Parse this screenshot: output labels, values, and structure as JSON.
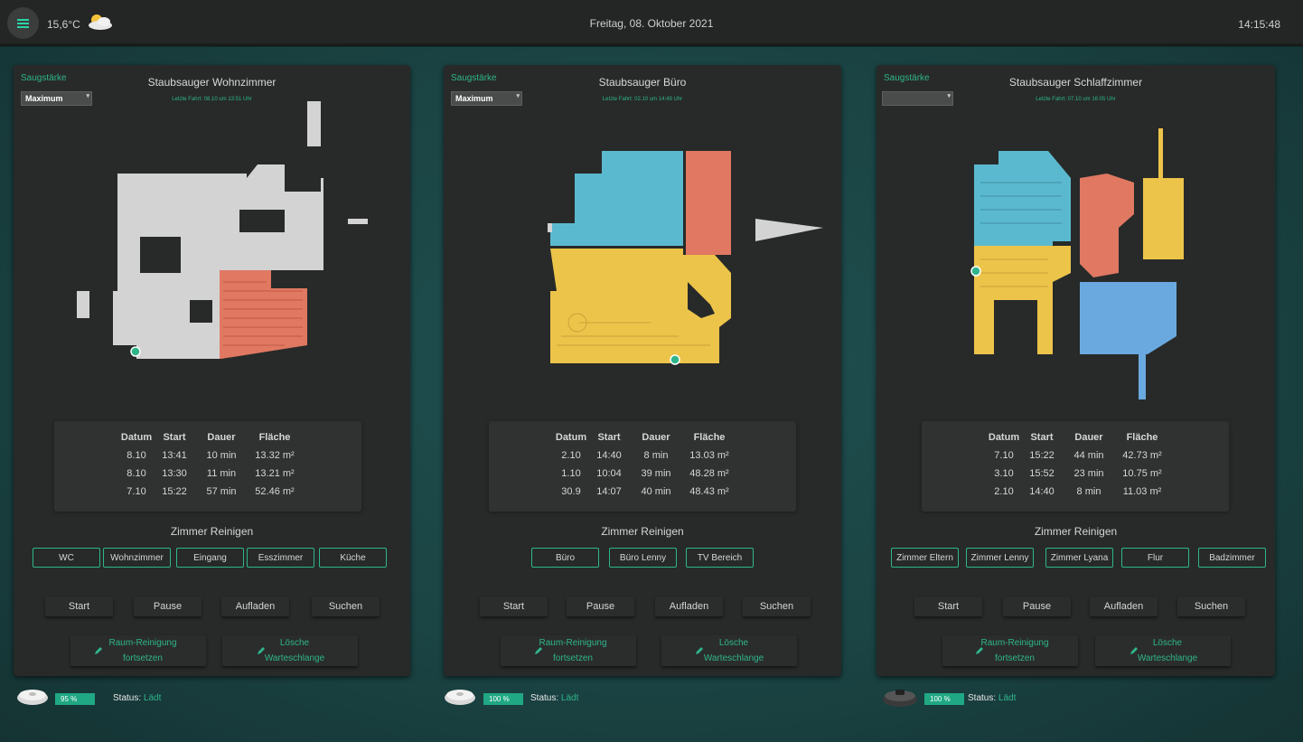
{
  "header": {
    "temperature": "15,6°C",
    "weather_icon": "partly-cloudy-icon",
    "date": "Freitag, 08. Oktober 2021",
    "time": "14:15:48"
  },
  "colors": {
    "accent": "#2fb58b",
    "room_orange": "#e07862",
    "room_blue": "#5bb9cf",
    "room_yellow": "#edc44a",
    "room_lightblue": "#6aa9e0",
    "room_gray": "#d3d3d3"
  },
  "vacuums": [
    {
      "suction_label": "Saugstärke",
      "suction_value": "Maximum",
      "title": "Staubsauger Wohnzimmer",
      "last_run": "Letzte Fahrt: 08.10 um 13:51 Uhr",
      "history_headers": [
        "Datum",
        "Start",
        "Dauer",
        "Fläche"
      ],
      "history": [
        [
          "8.10",
          "13:41",
          "10 min",
          "13.32 m²"
        ],
        [
          "8.10",
          "13:30",
          "11 min",
          "13.21 m²"
        ],
        [
          "7.10",
          "15:22",
          "57 min",
          "52.46 m²"
        ]
      ],
      "rooms_title": "Zimmer Reinigen",
      "rooms": [
        "WC",
        "Wohnzimmer",
        "Eingang",
        "Esszimmer",
        "Küche"
      ],
      "actions": [
        "Start",
        "Pause",
        "Aufladen",
        "Suchen"
      ],
      "resume_label": [
        "Raum-Reinigung",
        "fortsetzen"
      ],
      "clear_label": [
        "Lösche",
        "Warteschlange"
      ],
      "battery": "95 %",
      "battery_level": 0.95,
      "status_label": "Status:",
      "status_value": "Lädt"
    },
    {
      "suction_label": "Saugstärke",
      "suction_value": "Maximum",
      "title": "Staubsauger Büro",
      "last_run": "Letzte Fahrt: 02.10 um 14:49 Uhr",
      "history_headers": [
        "Datum",
        "Start",
        "Dauer",
        "Fläche"
      ],
      "history": [
        [
          "2.10",
          "14:40",
          "8 min",
          "13.03 m²"
        ],
        [
          "1.10",
          "10:04",
          "39 min",
          "48.28 m²"
        ],
        [
          "30.9",
          "14:07",
          "40 min",
          "48.43 m²"
        ]
      ],
      "rooms_title": "Zimmer Reinigen",
      "rooms": [
        "Büro",
        "Büro Lenny",
        "TV Bereich"
      ],
      "actions": [
        "Start",
        "Pause",
        "Aufladen",
        "Suchen"
      ],
      "resume_label": [
        "Raum-Reinigung",
        "fortsetzen"
      ],
      "clear_label": [
        "Lösche",
        "Warteschlange"
      ],
      "battery": "100 %",
      "battery_level": 1.0,
      "status_label": "Status:",
      "status_value": "Lädt"
    },
    {
      "suction_label": "Saugstärke",
      "suction_value": "",
      "title": "Staubsauger Schlaffzimmer",
      "last_run": "Letzte Fahrt: 07.10 um 16:05 Uhr",
      "history_headers": [
        "Datum",
        "Start",
        "Dauer",
        "Fläche"
      ],
      "history": [
        [
          "7.10",
          "15:22",
          "44 min",
          "42.73 m²"
        ],
        [
          "3.10",
          "15:52",
          "23 min",
          "10.75 m²"
        ],
        [
          "2.10",
          "14:40",
          "8 min",
          "11.03 m²"
        ]
      ],
      "rooms_title": "Zimmer Reinigen",
      "rooms": [
        "Zimmer Eltern",
        "Zimmer Lenny",
        "Zimmer Lyana",
        "Flur",
        "Badzimmer"
      ],
      "actions": [
        "Start",
        "Pause",
        "Aufladen",
        "Suchen"
      ],
      "resume_label": [
        "Raum-Reinigung",
        "fortsetzen"
      ],
      "clear_label": [
        "Lösche",
        "Warteschlange"
      ],
      "battery": "100 %",
      "battery_level": 1.0,
      "status_label": "Status:",
      "status_value": "Lädt"
    }
  ]
}
